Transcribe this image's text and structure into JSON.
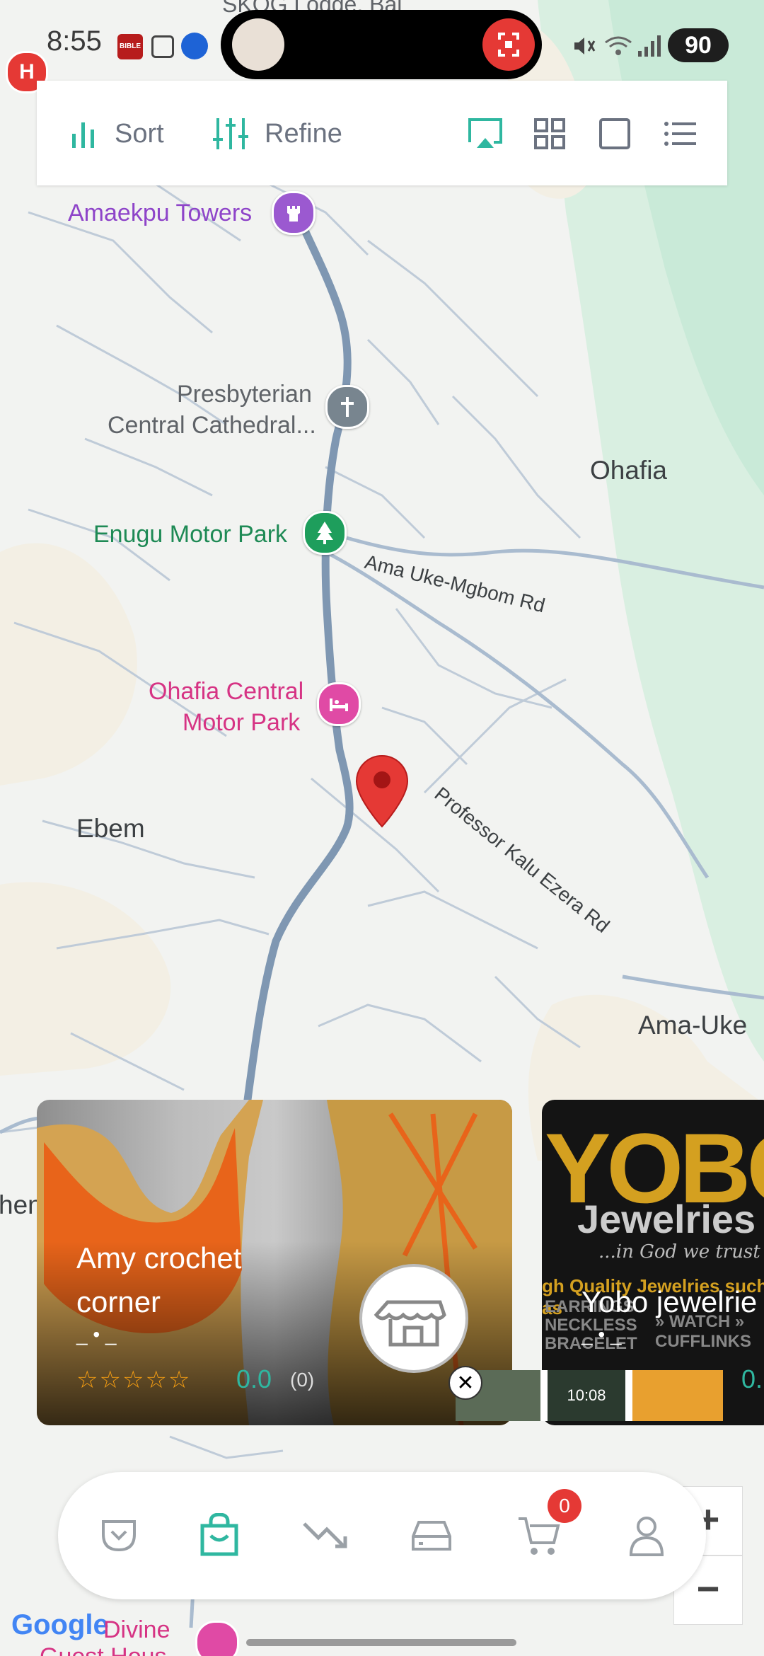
{
  "status_bar": {
    "time": "8:55",
    "battery": "90",
    "bible_badge": "BIBLE"
  },
  "toolbar": {
    "sort_label": "Sort",
    "refine_label": "Refine"
  },
  "map": {
    "top_label": "SKOG Lodge, Bai",
    "places": {
      "amaekpu": "Amaekpu Towers",
      "presbyterian_line1": "Presbyterian",
      "presbyterian_line2": "Central Cathedral...",
      "ohafia": "Ohafia",
      "enugu_park": "Enugu Motor Park",
      "ama_uke_rd": "Ama Uke-Mgbom Rd",
      "ohafia_central_line1": "Ohafia Central",
      "ohafia_central_line2": "Motor Park",
      "ebem": "Ebem",
      "kalu_rd": "Professor Kalu Ezera Rd",
      "ama_uke": "Ama-Uke",
      "edge_partial": "hen",
      "divine_line1": "Divine",
      "divine_line2": "Guest Hous"
    },
    "hotel_marker": "H",
    "google_logo": "Google",
    "zoom_in": "+",
    "zoom_out": "−"
  },
  "cards": [
    {
      "title_line1": "Amy crochet",
      "title_line2": "corner",
      "dots": "_ • _",
      "rating": "0.0",
      "reviews": "(0)",
      "stars": 0
    },
    {
      "brand_big": "YOBO",
      "brand_sub": "Jewelries",
      "tagline": "...in God we trust",
      "promo_line1": "gh Quality Jewelries such as",
      "promo_line2": "EARRINGS  NECKLESS  BRACELET",
      "promo_line3": "» WATCH  » CUFFLINKS",
      "title": "Yobo jewelrie",
      "dots": "_ • _",
      "rating": "0."
    }
  ],
  "ad": {
    "close": "✕",
    "watch_text": "10:08"
  },
  "bottom_nav": {
    "cart_count": "0"
  },
  "colors": {
    "accent": "#2fb7a0",
    "marker": "#e53935",
    "road": "#7f97b2",
    "water_green": "#c6ead7"
  }
}
